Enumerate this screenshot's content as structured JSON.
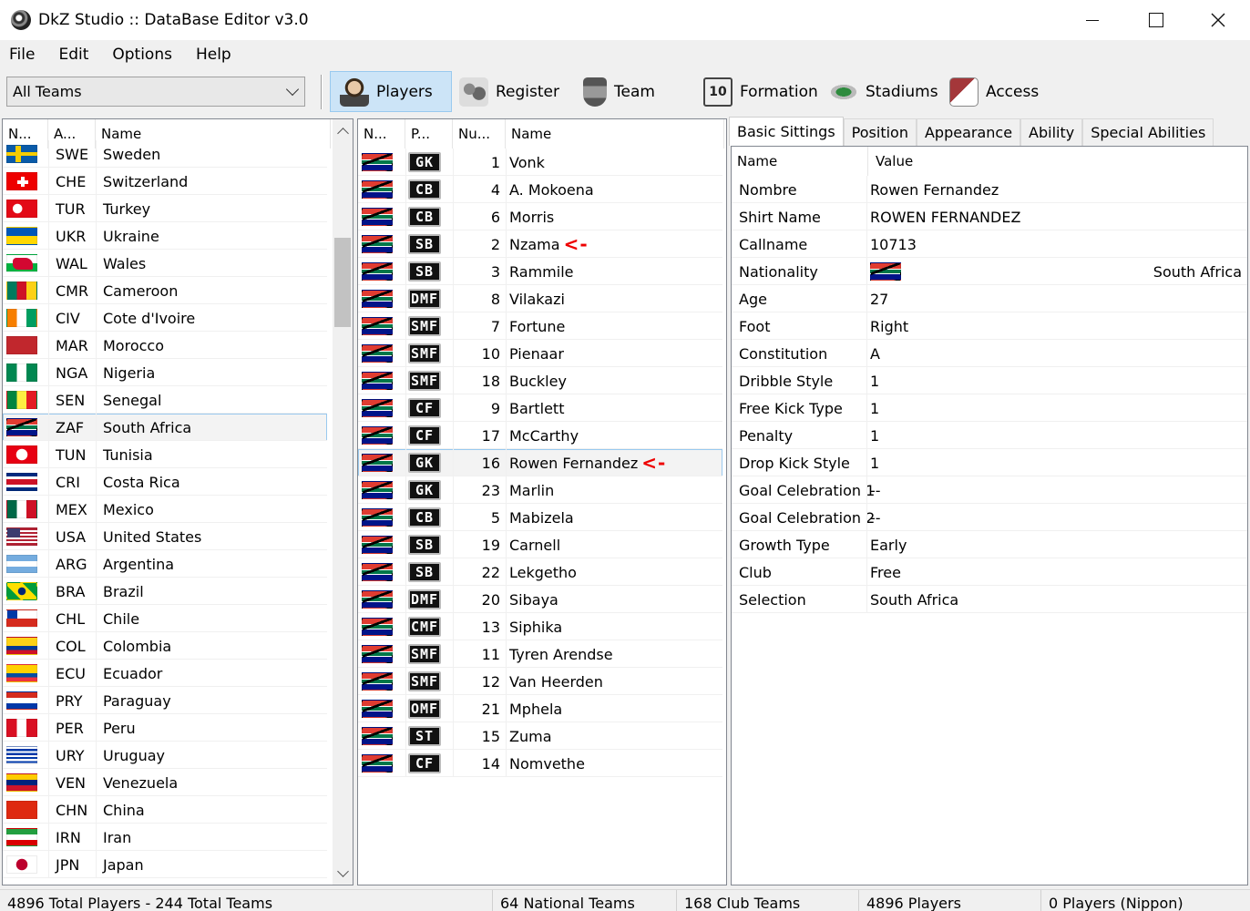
{
  "window": {
    "title": "DkZ Studio :: DataBase Editor v3.0"
  },
  "menu": [
    "File",
    "Edit",
    "Options",
    "Help"
  ],
  "toolbar": {
    "team_filter": "All Teams",
    "buttons": [
      {
        "label": "Players",
        "icon": "player-icon"
      },
      {
        "label": "Register",
        "icon": "register-icon"
      },
      {
        "label": "Team",
        "icon": "team-badge-icon"
      },
      {
        "label": "Formation",
        "icon": "formation-icon"
      },
      {
        "label": "Stadiums",
        "icon": "stadium-icon"
      },
      {
        "label": "Access",
        "icon": "access-icon"
      }
    ]
  },
  "teams_list": {
    "headers": [
      "N...",
      "A...",
      "Name"
    ],
    "selected": "ZAF",
    "rows": [
      {
        "flag": "f-sweden",
        "abbr": "SWE",
        "name": "Sweden"
      },
      {
        "flag": "f-swiss",
        "abbr": "CHE",
        "name": "Switzerland"
      },
      {
        "flag": "f-turkey",
        "abbr": "TUR",
        "name": "Turkey"
      },
      {
        "flag": "f-ukraine",
        "abbr": "UKR",
        "name": "Ukraine"
      },
      {
        "flag": "f-wales",
        "abbr": "WAL",
        "name": "Wales"
      },
      {
        "flag": "f-cameroon",
        "abbr": "CMR",
        "name": "Cameroon"
      },
      {
        "flag": "f-civ",
        "abbr": "CIV",
        "name": "Cote d'Ivoire"
      },
      {
        "flag": "f-morocco",
        "abbr": "MAR",
        "name": "Morocco"
      },
      {
        "flag": "f-nigeria",
        "abbr": "NGA",
        "name": "Nigeria"
      },
      {
        "flag": "f-senegal",
        "abbr": "SEN",
        "name": "Senegal"
      },
      {
        "flag": "f-sa",
        "abbr": "ZAF",
        "name": "South Africa"
      },
      {
        "flag": "f-tunisia",
        "abbr": "TUN",
        "name": "Tunisia"
      },
      {
        "flag": "f-costarica",
        "abbr": "CRI",
        "name": "Costa Rica"
      },
      {
        "flag": "f-mexico",
        "abbr": "MEX",
        "name": "Mexico"
      },
      {
        "flag": "f-usa",
        "abbr": "USA",
        "name": "United States"
      },
      {
        "flag": "f-argentina",
        "abbr": "ARG",
        "name": "Argentina"
      },
      {
        "flag": "f-brazil",
        "abbr": "BRA",
        "name": "Brazil"
      },
      {
        "flag": "f-chile",
        "abbr": "CHL",
        "name": "Chile"
      },
      {
        "flag": "f-colombia",
        "abbr": "COL",
        "name": "Colombia"
      },
      {
        "flag": "f-ecuador",
        "abbr": "ECU",
        "name": "Ecuador"
      },
      {
        "flag": "f-paraguay",
        "abbr": "PRY",
        "name": "Paraguay"
      },
      {
        "flag": "f-peru",
        "abbr": "PER",
        "name": "Peru"
      },
      {
        "flag": "f-uruguay",
        "abbr": "URY",
        "name": "Uruguay"
      },
      {
        "flag": "f-venezuela",
        "abbr": "VEN",
        "name": "Venezuela"
      },
      {
        "flag": "f-china",
        "abbr": "CHN",
        "name": "China"
      },
      {
        "flag": "f-iran",
        "abbr": "IRN",
        "name": "Iran"
      },
      {
        "flag": "f-japan",
        "abbr": "JPN",
        "name": "Japan"
      }
    ]
  },
  "players_list": {
    "headers": [
      "N...",
      "P...",
      "Nu...",
      "Name"
    ],
    "selected": "Rowen Fernandez",
    "marker": "<-",
    "rows": [
      {
        "pos": "GK",
        "num": "1",
        "name": "Vonk",
        "marked": false
      },
      {
        "pos": "CB",
        "num": "4",
        "name": "A. Mokoena",
        "marked": false
      },
      {
        "pos": "CB",
        "num": "6",
        "name": "Morris",
        "marked": false
      },
      {
        "pos": "SB",
        "num": "2",
        "name": "Nzama",
        "marked": true
      },
      {
        "pos": "SB",
        "num": "3",
        "name": "Rammile",
        "marked": false
      },
      {
        "pos": "DMF",
        "num": "8",
        "name": "Vilakazi",
        "marked": false
      },
      {
        "pos": "SMF",
        "num": "7",
        "name": "Fortune",
        "marked": false
      },
      {
        "pos": "SMF",
        "num": "10",
        "name": "Pienaar",
        "marked": false
      },
      {
        "pos": "SMF",
        "num": "18",
        "name": "Buckley",
        "marked": false
      },
      {
        "pos": "CF",
        "num": "9",
        "name": "Bartlett",
        "marked": false
      },
      {
        "pos": "CF",
        "num": "17",
        "name": "McCarthy",
        "marked": false
      },
      {
        "pos": "GK",
        "num": "16",
        "name": "Rowen Fernandez",
        "marked": true
      },
      {
        "pos": "GK",
        "num": "23",
        "name": "Marlin",
        "marked": false
      },
      {
        "pos": "CB",
        "num": "5",
        "name": "Mabizela",
        "marked": false
      },
      {
        "pos": "SB",
        "num": "19",
        "name": "Carnell",
        "marked": false
      },
      {
        "pos": "SB",
        "num": "22",
        "name": "Lekgetho",
        "marked": false
      },
      {
        "pos": "DMF",
        "num": "20",
        "name": "Sibaya",
        "marked": false
      },
      {
        "pos": "CMF",
        "num": "13",
        "name": "Siphika",
        "marked": false
      },
      {
        "pos": "SMF",
        "num": "11",
        "name": "Tyren Arendse",
        "marked": false
      },
      {
        "pos": "SMF",
        "num": "12",
        "name": "Van Heerden",
        "marked": false
      },
      {
        "pos": "OMF",
        "num": "21",
        "name": "Mphela",
        "marked": false
      },
      {
        "pos": "ST",
        "num": "15",
        "name": "Zuma",
        "marked": false
      },
      {
        "pos": "CF",
        "num": "14",
        "name": "Nomvethe",
        "marked": false
      }
    ]
  },
  "details": {
    "tabs": [
      "Basic Sittings",
      "Position",
      "Appearance",
      "Ability",
      "Special Abilities"
    ],
    "active_tab": "Basic Sittings",
    "headers": [
      "Name",
      "Value"
    ],
    "rows": [
      {
        "name": "Nombre",
        "value": "Rowen Fernandez"
      },
      {
        "name": "Shirt Name",
        "value": "ROWEN FERNANDEZ"
      },
      {
        "name": "Callname",
        "value": "10713"
      },
      {
        "name": "Nationality",
        "value": "South Africa",
        "flag": "f-sa"
      },
      {
        "name": "Age",
        "value": "27"
      },
      {
        "name": "Foot",
        "value": "Right"
      },
      {
        "name": "Constitution",
        "value": "A"
      },
      {
        "name": "Dribble Style",
        "value": "1"
      },
      {
        "name": "Free Kick Type",
        "value": "1"
      },
      {
        "name": "Penalty",
        "value": "1"
      },
      {
        "name": "Drop Kick Style",
        "value": "1"
      },
      {
        "name": "Goal Celebration 1",
        "value": "--"
      },
      {
        "name": "Goal Celebration 2",
        "value": "--"
      },
      {
        "name": "Growth Type",
        "value": "Early"
      },
      {
        "name": "Club",
        "value": "Free"
      },
      {
        "name": "Selection",
        "value": "South Africa"
      }
    ]
  },
  "status": [
    "4896 Total Players  -  244 Total Teams",
    "64 National Teams",
    "168 Club Teams",
    "4896 Players",
    "0 Players (Nippon)"
  ]
}
